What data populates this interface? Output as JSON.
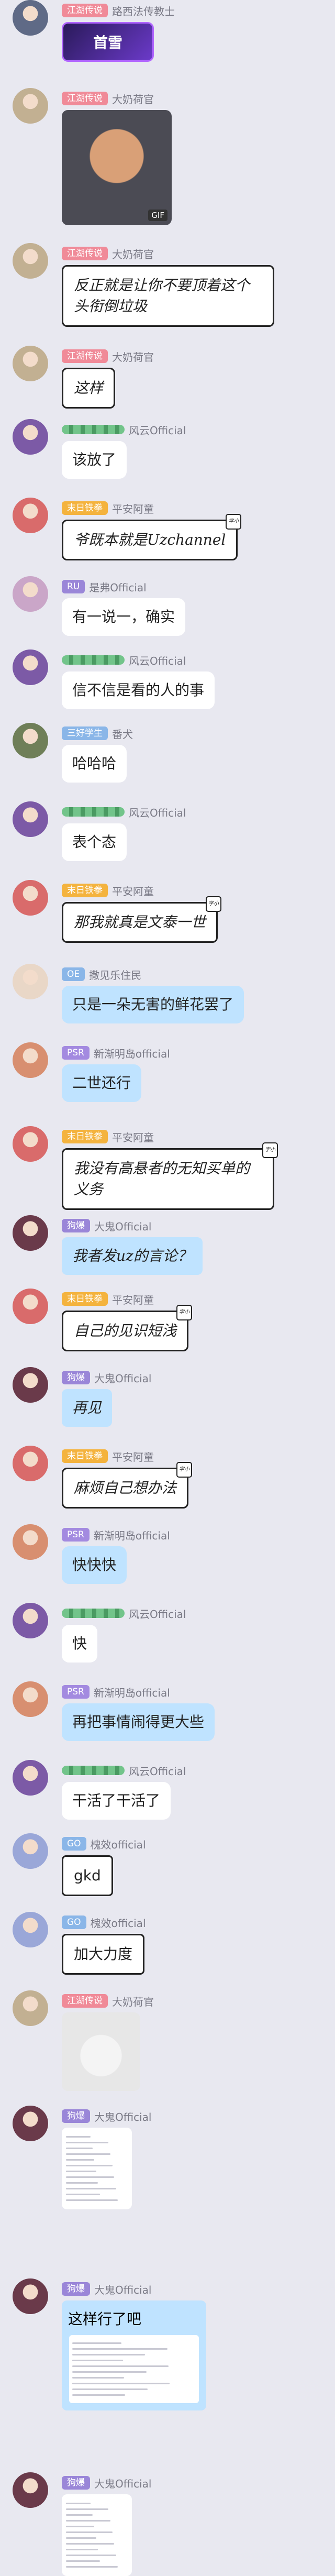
{
  "messages": [
    {
      "badge": "江湖传说",
      "badge_color": "#f08a98",
      "name": "路西法传教士",
      "avatar": "#5f6a86",
      "kind": "image_banner",
      "banner_text": "首雪"
    },
    {
      "badge": "江湖传说",
      "badge_color": "#f08a98",
      "name": "大奶荷官",
      "avatar": "#c2b092",
      "kind": "gif",
      "gif_label": "GIF"
    },
    {
      "badge": "江湖传说",
      "badge_color": "#f08a98",
      "name": "大奶荷官",
      "avatar": "#c2b092",
      "kind": "script",
      "text": "反正就是让你不要顶着这个头衔倒垃圾"
    },
    {
      "badge": "江湖传说",
      "badge_color": "#f08a98",
      "name": "大奶荷官",
      "avatar": "#c2b092",
      "kind": "script",
      "text": "这样"
    },
    {
      "badge": "",
      "badge_color": "#7fcf96",
      "name": "风云Official",
      "avatar": "#7c5aa6",
      "kind": "plain",
      "text": "该放了"
    },
    {
      "badge": "末日铁拳",
      "badge_color": "#f4b33e",
      "name": "平安阿童",
      "avatar": "#d96b6b",
      "kind": "script",
      "text": "爷既本就是Uzchannel",
      "tag": "字小"
    },
    {
      "badge": "RU",
      "badge_color": "#9a86d8",
      "name": "是弗Official",
      "avatar": "#caa6c8",
      "kind": "plain",
      "text": "有一说一，确实"
    },
    {
      "badge": "",
      "badge_color": "#7fcf96",
      "name": "风云Official",
      "avatar": "#7c5aa6",
      "kind": "plain",
      "text": "信不信是看的人的事"
    },
    {
      "badge": "三好学生",
      "badge_color": "#8ab6e8",
      "name": "番犬",
      "avatar": "#6f7f58",
      "kind": "plain",
      "text": "哈哈哈"
    },
    {
      "badge": "",
      "badge_color": "#7fcf96",
      "name": "风云Official",
      "avatar": "#7c5aa6",
      "kind": "plain",
      "text": "表个态"
    },
    {
      "badge": "末日铁拳",
      "badge_color": "#f4b33e",
      "name": "平安阿童",
      "avatar": "#d96b6b",
      "kind": "script",
      "text": "那我就真是文泰一世",
      "tag": "字小"
    },
    {
      "badge": "OE",
      "badge_color": "#8ab6e8",
      "name": "撒见乐住民",
      "avatar": "#e9d7c7",
      "kind": "blue",
      "text": "只是一朵无害的鲜花罢了"
    },
    {
      "badge": "PSR",
      "badge_color": "#a38ae0",
      "name": "新渐明岛official",
      "avatar": "#d88f70",
      "kind": "blue",
      "text": "二世还行"
    },
    {
      "badge": "末日铁拳",
      "badge_color": "#f4b33e",
      "name": "平安阿童",
      "avatar": "#d96b6b",
      "kind": "script",
      "text": "我没有高悬者的无知买单的义务",
      "tag": "字小"
    },
    {
      "badge": "狗爆",
      "badge_color": "#9a86d8",
      "name": "大鬼Official",
      "avatar": "#6a3a4a",
      "kind": "blue_script",
      "text": "我者发uz的言论？"
    },
    {
      "badge": "末日铁拳",
      "badge_color": "#f4b33e",
      "name": "平安阿童",
      "avatar": "#d96b6b",
      "kind": "script",
      "text": "自己的见识短浅",
      "tag": "字小"
    },
    {
      "badge": "狗爆",
      "badge_color": "#9a86d8",
      "name": "大鬼Official",
      "avatar": "#6a3a4a",
      "kind": "blue_script",
      "text": "再见"
    },
    {
      "badge": "末日铁拳",
      "badge_color": "#f4b33e",
      "name": "平安阿童",
      "avatar": "#d96b6b",
      "kind": "script",
      "text": "麻烦自己想办法",
      "tag": "字小"
    },
    {
      "badge": "PSR",
      "badge_color": "#a38ae0",
      "name": "新渐明岛official",
      "avatar": "#d88f70",
      "kind": "blue",
      "text": "快快快"
    },
    {
      "badge": "",
      "badge_color": "#7fcf96",
      "name": "风云Official",
      "avatar": "#7c5aa6",
      "kind": "plain",
      "text": "快"
    },
    {
      "badge": "PSR",
      "badge_color": "#a38ae0",
      "name": "新渐明岛official",
      "avatar": "#d88f70",
      "kind": "blue",
      "text": "再把事情闹得更大些"
    },
    {
      "badge": "",
      "badge_color": "#7fcf96",
      "name": "风云Official",
      "avatar": "#7c5aa6",
      "kind": "plain",
      "text": "干活了干活了"
    },
    {
      "badge": "GO",
      "badge_color": "#8ab6e8",
      "name": "槐效official",
      "avatar": "#9aa7d8",
      "kind": "bw",
      "text": "gkd"
    },
    {
      "badge": "GO",
      "badge_color": "#8ab6e8",
      "name": "槐效official",
      "avatar": "#9aa7d8",
      "kind": "bw",
      "text": "加大力度"
    },
    {
      "badge": "江湖传说",
      "badge_color": "#f08a98",
      "name": "大奶荷官",
      "avatar": "#c2b092",
      "kind": "sticker"
    },
    {
      "badge": "狗爆",
      "badge_color": "#9a86d8",
      "name": "大鬼Official",
      "avatar": "#6a3a4a",
      "kind": "doc"
    },
    {
      "badge": "狗爆",
      "badge_color": "#9a86d8",
      "name": "大鬼Official",
      "avatar": "#6a3a4a",
      "kind": "blue_doc",
      "text": "这样行了吧"
    },
    {
      "badge": "狗爆",
      "badge_color": "#9a86d8",
      "name": "大鬼Official",
      "avatar": "#6a3a4a",
      "kind": "doc"
    }
  ]
}
